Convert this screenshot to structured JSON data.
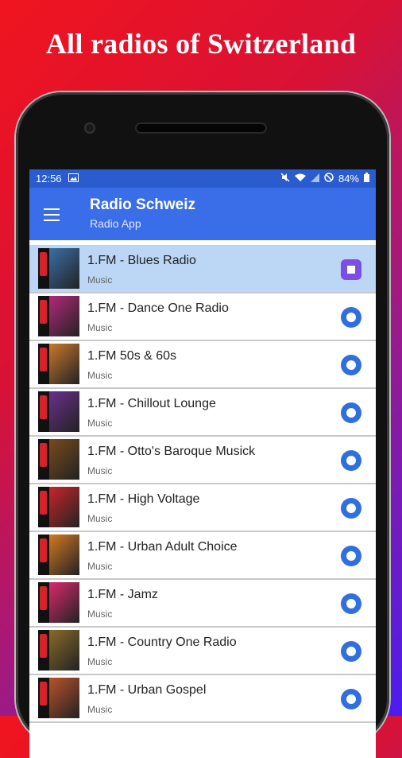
{
  "promo": {
    "headline": "All radios of Switzerland"
  },
  "status_bar": {
    "time": "12:56",
    "battery": "84%"
  },
  "app_bar": {
    "title": "Radio Schweiz",
    "subtitle": "Radio App"
  },
  "stations": [
    {
      "name": "1.FM - Blues Radio",
      "genre": "Music",
      "state": "playing",
      "color": "#3b6fa8"
    },
    {
      "name": "1.FM - Dance One Radio",
      "genre": "Music",
      "state": "idle",
      "color": "#b02a7a"
    },
    {
      "name": "1.FM 50s & 60s",
      "genre": "Music",
      "state": "idle",
      "color": "#c9782c"
    },
    {
      "name": "1.FM - Chillout Lounge",
      "genre": "Music",
      "state": "idle",
      "color": "#6b2f8e"
    },
    {
      "name": "1.FM - Otto's Baroque Musick",
      "genre": "Music",
      "state": "idle",
      "color": "#7a4a1c"
    },
    {
      "name": "1.FM - High Voltage",
      "genre": "Music",
      "state": "idle",
      "color": "#c8262b"
    },
    {
      "name": "1.FM - Urban Adult Choice",
      "genre": "Music",
      "state": "idle",
      "color": "#d17a22"
    },
    {
      "name": "1.FM - Jamz",
      "genre": "Music",
      "state": "idle",
      "color": "#d92a6e"
    },
    {
      "name": "1.FM - Country One Radio",
      "genre": "Music",
      "state": "idle",
      "color": "#8a6a2a"
    },
    {
      "name": "1.FM - Urban Gospel",
      "genre": "Music",
      "state": "idle",
      "color": "#b8532a"
    }
  ]
}
